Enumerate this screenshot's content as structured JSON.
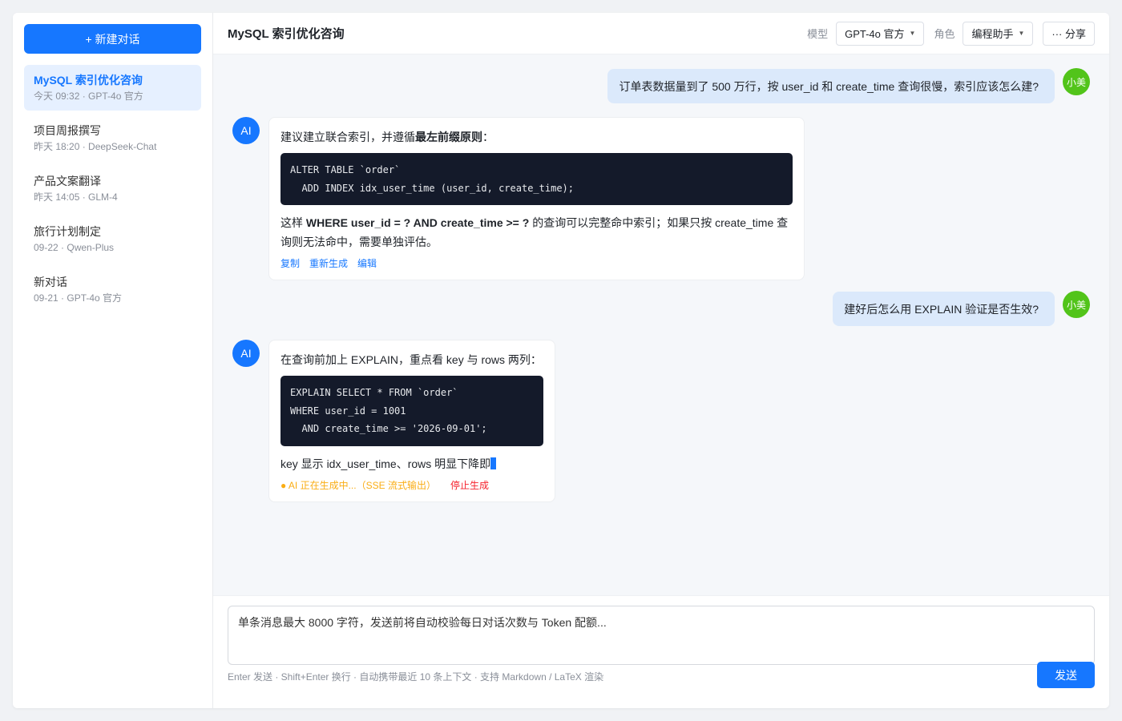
{
  "sidebar": {
    "new_chat_label": "+ 新建对话",
    "conversations": [
      {
        "title": "MySQL 索引优化咨询",
        "meta": "今天 09:32 · GPT-4o 官方",
        "active": true
      },
      {
        "title": "项目周报撰写",
        "meta": "昨天 18:20 · DeepSeek-Chat"
      },
      {
        "title": "产品文案翻译",
        "meta": "昨天 14:05 · GLM-4"
      },
      {
        "title": "旅行计划制定",
        "meta": "09-22 · Qwen-Plus"
      },
      {
        "title": "新对话",
        "meta": "09-21 · GPT-4o 官方"
      }
    ]
  },
  "header": {
    "title": "MySQL 索引优化咨询",
    "model_label": "模型",
    "model_value": "GPT-4o 官方",
    "role_label": "角色",
    "role_value": "编程助手",
    "share_label": "··· 分享"
  },
  "messages": {
    "user_avatar": "小美",
    "ai_avatar": "AI",
    "m1_user": "订单表数据量到了 500 万行，按 user_id 和 create_time 查询很慢，索引应该怎么建?",
    "m2_intro_a": "建议建立联合索引，并遵循",
    "m2_intro_b": "最左前缀原则",
    "m2_intro_c": "：",
    "m2_code": [
      "ALTER TABLE `order`",
      "  ADD INDEX idx_user_time (user_id, create_time);"
    ],
    "m2_text_a": "这样 ",
    "m2_text_b": "WHERE user_id = ? AND create_time >= ?",
    "m2_text_c": " 的查询可以完整命中索引；如果只按 create_time 查询则无法命中，需要单独评估。",
    "m2_actions": [
      "复制",
      "重新生成",
      "编辑"
    ],
    "m3_user": "建好后怎么用 EXPLAIN 验证是否生效?",
    "m4_intro": "在查询前加上 EXPLAIN，重点看 key 与 rows 两列：",
    "m4_code": [
      "EXPLAIN SELECT * FROM `order`",
      "WHERE user_id = 1001",
      "  AND create_time >= '2026-09-01';"
    ],
    "m4_text": "key 显示 idx_user_time、rows 明显下降即",
    "m4_status": "● AI 正在生成中...（SSE 流式输出）",
    "m4_stop": "停止生成"
  },
  "input": {
    "placeholder": "单条消息最大 8000 字符，发送前将自动校验每日对话次数与 Token 配额...",
    "hint": "Enter 发送 · Shift+Enter 换行 · 自动携带最近 10 条上下文 · 支持 Markdown / LaTeX 渲染",
    "send_label": "发送"
  },
  "colors": {
    "accent": "#1677ff",
    "user_avatar": "#52c41a",
    "user_bubble": "#dbe9fb",
    "code_bg": "#141a2a",
    "status": "#faad14",
    "stop": "#f5222d"
  }
}
